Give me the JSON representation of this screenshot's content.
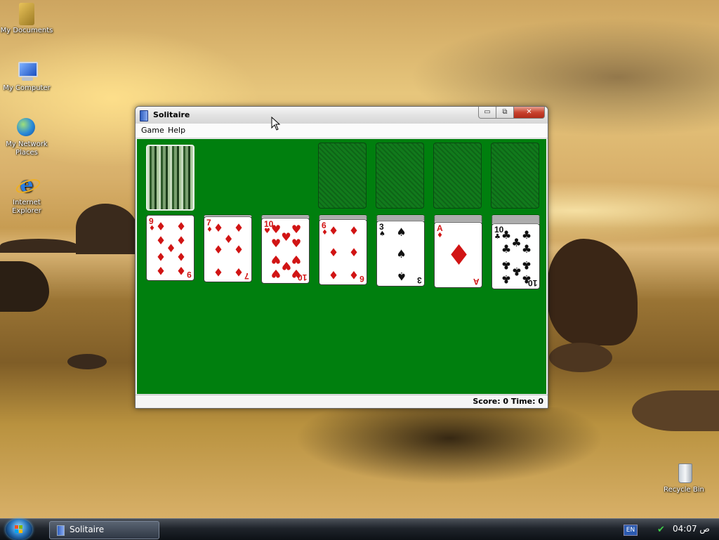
{
  "desktop": {
    "icons": [
      {
        "label_line1": "My Documents",
        "label_line2": "",
        "icon": "my-documents-icon"
      },
      {
        "label_line1": "My Computer",
        "label_line2": "",
        "icon": "my-computer-icon"
      },
      {
        "label_line1": "My Network",
        "label_line2": "Places",
        "icon": "my-network-places-icon"
      },
      {
        "label_line1": "Internet",
        "label_line2": "Explorer",
        "icon": "internet-explorer-icon"
      },
      {
        "label_line1": "Recycle Bin",
        "label_line2": "",
        "icon": "recycle-bin-icon"
      }
    ]
  },
  "window": {
    "title": "Solitaire",
    "controls": {
      "minimize": "▭",
      "maximize": "⧉",
      "close": "✕"
    },
    "menu": [
      "Game",
      "Help"
    ],
    "status": "Score: 0  Time: 0"
  },
  "board": {
    "background": "#007f0e",
    "stock": {
      "face": "bamboo card back"
    },
    "foundations": 4,
    "tableau": [
      {
        "hidden": 0,
        "rank": "9",
        "suit": "♦",
        "color": "red"
      },
      {
        "hidden": 1,
        "rank": "7",
        "suit": "♦",
        "color": "red"
      },
      {
        "hidden": 2,
        "rank": "10",
        "suit": "♥",
        "color": "red"
      },
      {
        "hidden": 3,
        "rank": "6",
        "suit": "♦",
        "color": "red"
      },
      {
        "hidden": 4,
        "rank": "3",
        "suit": "♠",
        "color": "black"
      },
      {
        "hidden": 5,
        "rank": "A",
        "suit": "♦",
        "color": "red"
      },
      {
        "hidden": 6,
        "rank": "10",
        "suit": "♣",
        "color": "black"
      }
    ]
  },
  "taskbar": {
    "task_label": "Solitaire",
    "language": "EN",
    "clock": "04:07 ص"
  },
  "colors": {
    "felt": "#007f0e",
    "red_suit": "#d11414",
    "black_suit": "#111111",
    "close_button": "#c8422e"
  }
}
